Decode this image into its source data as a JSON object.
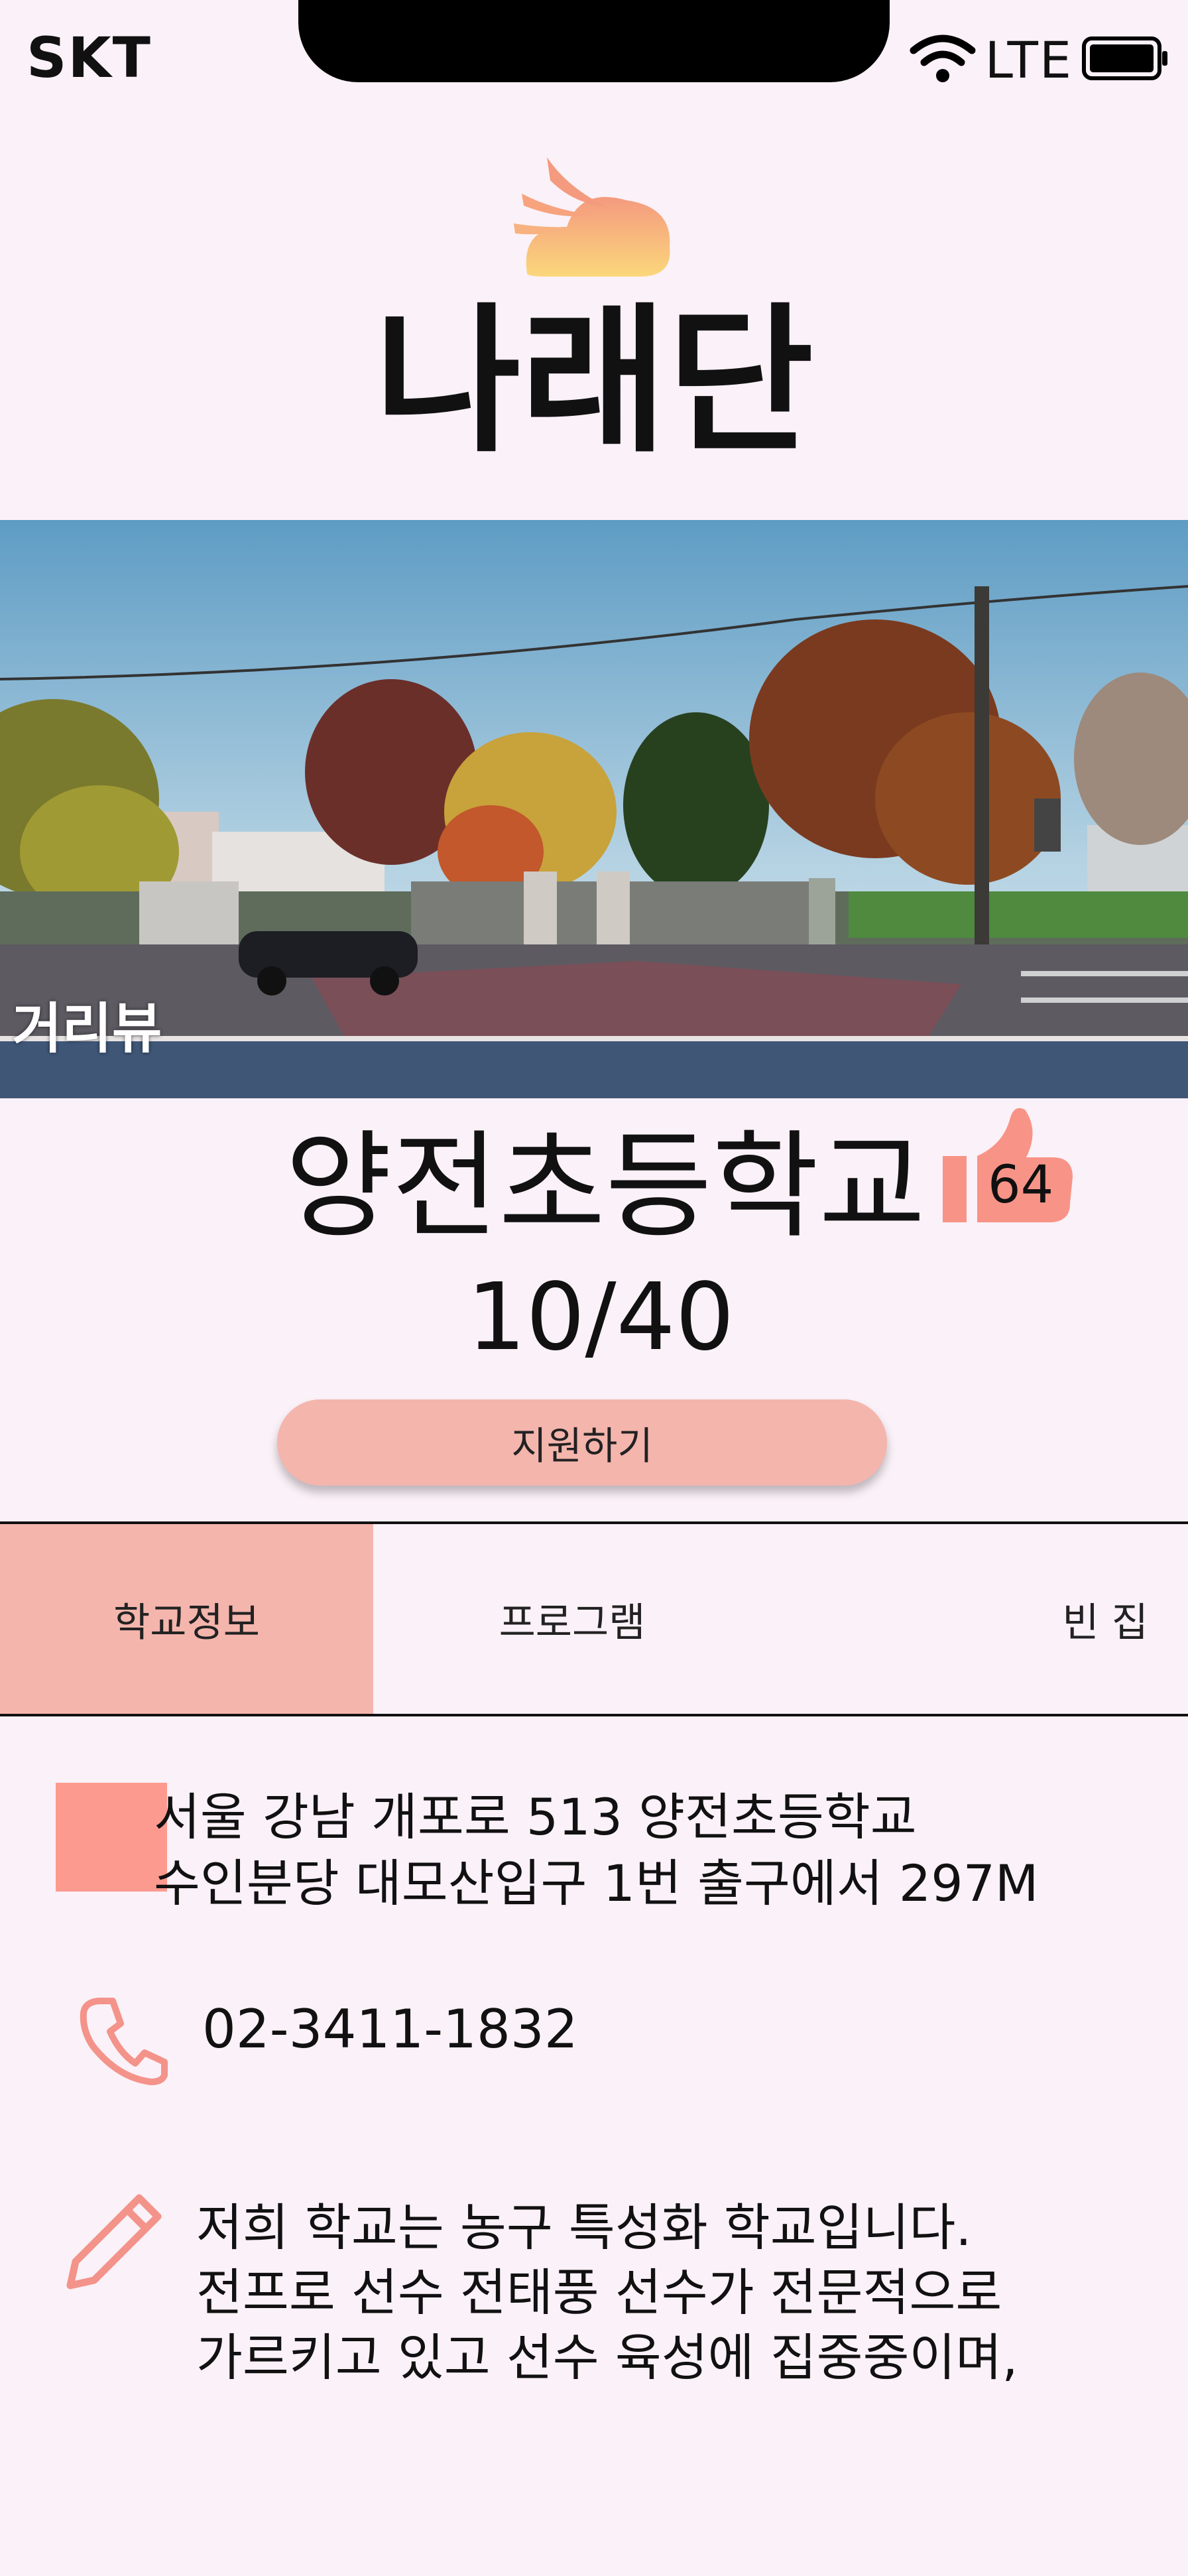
{
  "status_bar": {
    "carrier": "SKT",
    "network": "LTE",
    "wifi_icon": "wifi-icon",
    "battery_icon": "battery-icon"
  },
  "app": {
    "logo_icon": "cloud-wings-icon",
    "title": "나래단"
  },
  "street_view": {
    "label": "거리뷰"
  },
  "school": {
    "name": "양전초등학교",
    "likes": "64",
    "capacity": "10/40",
    "apply_label": "지원하기"
  },
  "tabs": [
    {
      "label": "학교정보",
      "active": true
    },
    {
      "label": "프로그램",
      "active": false
    },
    {
      "label": "빈 집",
      "active": false
    }
  ],
  "info": {
    "address_line1": "서울 강남 개포로 513 양전초등학교",
    "address_line2": "수인분당 대모산입구 1번 출구에서 297M",
    "phone": "02-3411-1832",
    "description_line1": "저희 학교는 농구 특성화 학교입니다.",
    "description_line2": "전프로 선수 전태풍 선수가 전문적으로",
    "description_line3": "가르키고 있고 선수 육성에 집중중이며,"
  },
  "colors": {
    "background": "#fbf1f8",
    "accent": "#f4b5ad",
    "marker": "#fd9a8f",
    "logo_gradient_top": "#f49a7e",
    "logo_gradient_bottom": "#fbd77c"
  }
}
